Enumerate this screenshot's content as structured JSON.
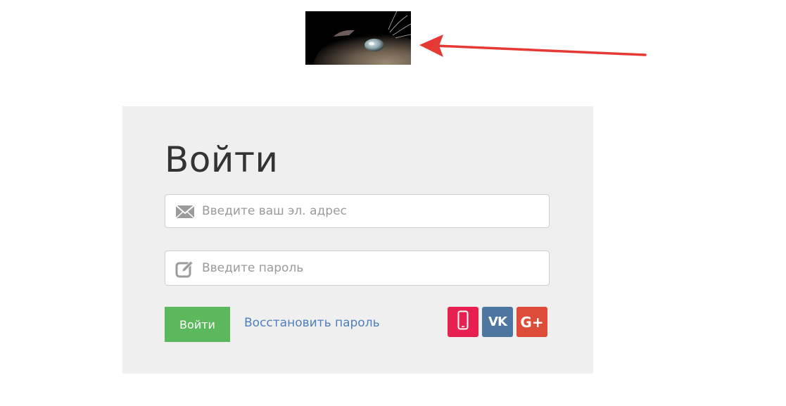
{
  "logo": {
    "alt": "cat-photo"
  },
  "login": {
    "title": "Войти",
    "email": {
      "placeholder": "Введите ваш эл. адрес",
      "value": "",
      "icon": "envelope-icon"
    },
    "password": {
      "placeholder": "Введите пароль",
      "value": "",
      "icon": "edit-icon"
    },
    "submit_label": "Войти",
    "restore_link": "Восстановить пароль",
    "social": [
      {
        "name": "phone",
        "icon": "phone-icon",
        "color": "#e8204f"
      },
      {
        "name": "vk",
        "label": "VK",
        "color": "#4c76a0"
      },
      {
        "name": "google-plus",
        "label": "G+",
        "color": "#dd4b39"
      }
    ]
  },
  "colors": {
    "panel_bg": "#efefef",
    "button_green": "#5cb85c",
    "link_blue": "#4f7fb8",
    "arrow_red": "#e53935"
  }
}
